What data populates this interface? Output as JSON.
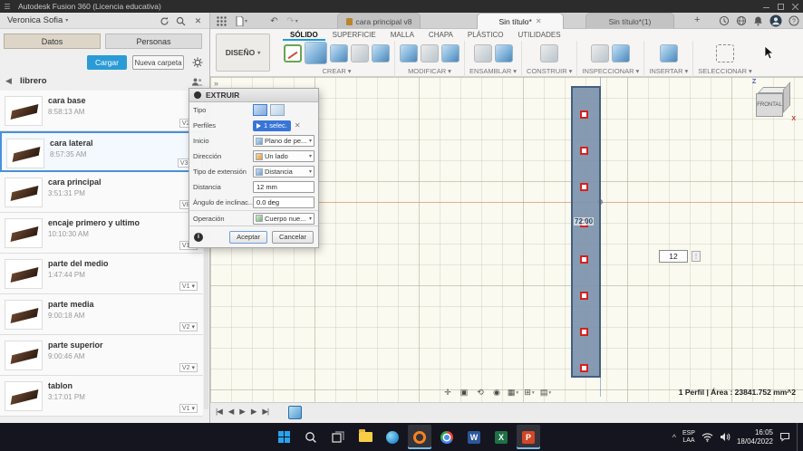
{
  "titlebar": {
    "title": "Autodesk Fusion 360 (Licencia educativa)"
  },
  "appbar": {
    "user_menu": "Veronica Sofia",
    "left_icon_names": [
      "apps-grid-icon",
      "file-menu-icon",
      "undo-icon",
      "redo-icon"
    ],
    "right_icon_names": [
      "history-icon",
      "globe-icon",
      "notifications-bell-icon",
      "user-avatar",
      "help-icon"
    ],
    "doc_tabs": [
      {
        "label": "cara principal v8",
        "active": false
      },
      {
        "label": "Sin título*",
        "active": true
      },
      {
        "label": "Sin título*(1)",
        "active": false
      }
    ]
  },
  "data_panel": {
    "tab_datos": "Datos",
    "tab_personas": "Personas",
    "upload_button": "Cargar",
    "new_folder_button": "Nueva carpeta",
    "folder_name": "librero",
    "items": [
      {
        "name": "cara base",
        "time": "8:58:13 AM",
        "version": "V2",
        "selected": false
      },
      {
        "name": "cara lateral",
        "time": "8:57:35 AM",
        "version": "V3",
        "selected": true
      },
      {
        "name": "cara principal",
        "time": "3:51:31 PM",
        "version": "V8",
        "selected": false
      },
      {
        "name": "encaje primero y ultimo",
        "time": "10:10:30 AM",
        "version": "V1",
        "selected": false
      },
      {
        "name": "parte del medio",
        "time": "1:47:44 PM",
        "version": "V1",
        "selected": false
      },
      {
        "name": "parte media",
        "time": "9:00:18 AM",
        "version": "V2",
        "selected": false
      },
      {
        "name": "parte superior",
        "time": "9:00:46 AM",
        "version": "V2",
        "selected": false
      },
      {
        "name": "tablon",
        "time": "3:17:01 PM",
        "version": "V1",
        "selected": false
      }
    ]
  },
  "ribbon": {
    "workspace_button": "DISEÑO",
    "tabs": [
      {
        "label": "SÓLIDO",
        "active": true
      },
      {
        "label": "SUPERFICIE",
        "active": false
      },
      {
        "label": "MALLA",
        "active": false
      },
      {
        "label": "CHAPA",
        "active": false
      },
      {
        "label": "PLÁSTICO",
        "active": false
      },
      {
        "label": "UTILIDADES",
        "active": false
      }
    ],
    "groups": [
      {
        "label": "CREAR"
      },
      {
        "label": "MODIFICAR"
      },
      {
        "label": "ENSAMBLAR"
      },
      {
        "label": "CONSTRUIR"
      },
      {
        "label": "INSPECCIONAR"
      },
      {
        "label": "INSERTAR"
      },
      {
        "label": "SELECCIONAR"
      }
    ]
  },
  "dialog": {
    "title": "EXTRUIR",
    "labels": {
      "tipo": "Tipo",
      "perfiles": "Perfiles",
      "inicio": "Inicio",
      "direccion": "Dirección",
      "tipo_extension": "Tipo de extensión",
      "distancia": "Distancia",
      "angulo": "Ángulo de inclinac...",
      "operacion": "Operación"
    },
    "values": {
      "perfiles": "1 selec.",
      "inicio": "Plano de pe...",
      "direccion": "Un lado",
      "tipo_extension": "Distancia",
      "distancia": "12 mm",
      "angulo": "0.0 deg",
      "operacion": "Cuerpo nue..."
    },
    "ok_button": "Aceptar",
    "cancel_button": "Cancelar"
  },
  "canvas": {
    "dimension_input": "12",
    "profile_measure": "72.00",
    "viewcube_face": "FRONTAL",
    "axis_z": "Z",
    "axis_x": "X",
    "status_text": "1 Perfil | Área : 23841.752 mm^2",
    "nav_icon_names": [
      "pan-icon",
      "zoom-fit-icon",
      "orbit-icon",
      "look-at-icon",
      "display-settings-icon",
      "grid-settings-icon",
      "viewports-icon"
    ]
  },
  "timeline": {
    "control_icon_names": [
      "go-to-start-icon",
      "step-back-icon",
      "play-icon",
      "step-forward-icon",
      "go-to-end-icon"
    ],
    "feature_icon_names": [
      "sketch-feature-icon"
    ]
  },
  "taskbar": {
    "icon_names": [
      "start",
      "search",
      "task-view",
      "file-explorer",
      "edge",
      "fusion-360",
      "chrome",
      "word",
      "excel",
      "powerpoint"
    ],
    "app_letters": {
      "word": "W",
      "excel": "X",
      "powerpoint": "P"
    },
    "lang_line1": "ESP",
    "lang_line2": "LAA",
    "time": "16:05",
    "date": "18/04/2022"
  }
}
